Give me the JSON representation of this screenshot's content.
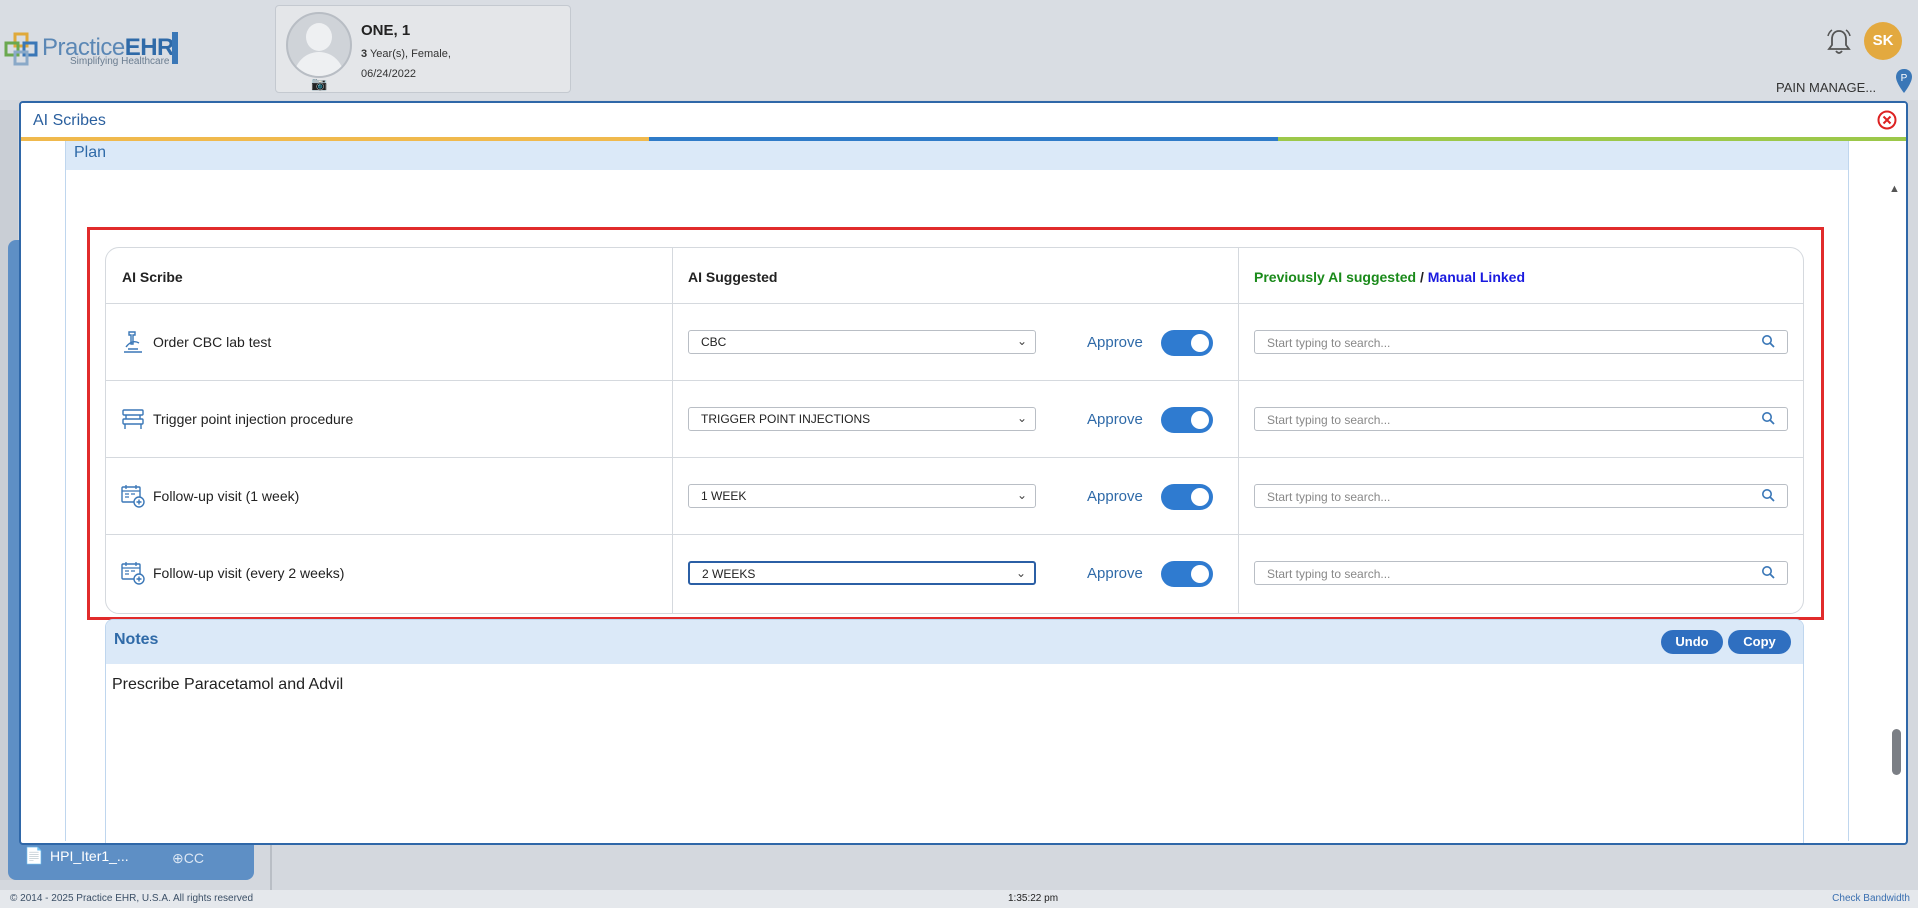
{
  "app": {
    "logo_main": "Practice",
    "logo_brand": "EHR",
    "logo_tagline": "Simplifying Healthcare"
  },
  "patient": {
    "name": "ONE, 1",
    "age_num": "3",
    "age_text": " Year(s), Female,",
    "dob": "06/24/2022"
  },
  "header": {
    "user_initials": "SK",
    "facility": "PAIN MANAGE...",
    "pin_label": "P"
  },
  "modal": {
    "title": "AI Scribes",
    "section_title": "Plan",
    "progress_colors": [
      "#f0b94d",
      "#2f7bc8",
      "#9cc84a"
    ]
  },
  "table": {
    "headers": {
      "col1": "AI Scribe",
      "col2": "AI Suggested",
      "col3_prev": "Previously AI suggested",
      "col3_sep": " / ",
      "col3_manual": "Manual Linked"
    },
    "approve_label": "Approve",
    "search_placeholder": "Start typing to search...",
    "rows": [
      {
        "icon": "microscope-icon",
        "label": "Order CBC lab test",
        "suggested": "CBC",
        "approved": true
      },
      {
        "icon": "procedure-bed-icon",
        "label": "Trigger point injection procedure",
        "suggested": "TRIGGER POINT INJECTIONS",
        "approved": true
      },
      {
        "icon": "calendar-add-icon",
        "label": "Follow-up visit (1 week)",
        "suggested": "1 WEEK",
        "approved": true
      },
      {
        "icon": "calendar-add-icon",
        "label": "Follow-up visit (every 2 weeks)",
        "suggested": "2 WEEKS",
        "approved": true
      }
    ]
  },
  "notes": {
    "title": "Notes",
    "undo_label": "Undo",
    "copy_label": "Copy",
    "text": "Prescribe Paracetamol and Advil"
  },
  "background": {
    "hpi_label": "HPI_Iter1_...",
    "cc_label": "CC"
  },
  "footer": {
    "copyright": "© 2014 - 2025 Practice EHR, U.S.A. All rights reserved",
    "time": "1:35:22 pm",
    "bandwidth_link": "Check Bandwidth"
  }
}
